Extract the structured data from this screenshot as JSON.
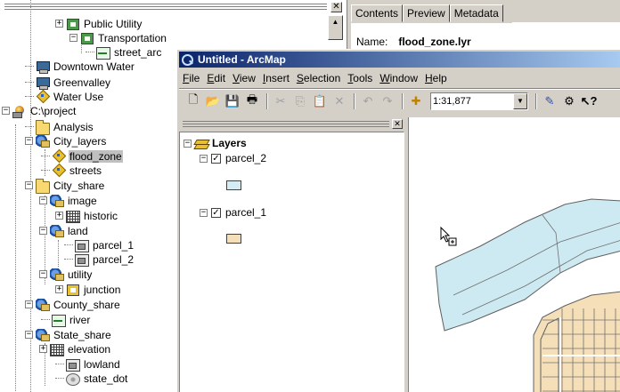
{
  "catalog": {
    "items": [
      {
        "label": "Public Utility",
        "icon": "network-dataset-icon"
      },
      {
        "label": "Transportation",
        "icon": "network-dataset-icon"
      },
      {
        "label": "street_arc",
        "icon": "line-featureclass-icon"
      },
      {
        "label": "Downtown Water",
        "icon": "computer-icon"
      },
      {
        "label": "Greenvalley",
        "icon": "computer-icon"
      },
      {
        "label": "Water Use",
        "icon": "layer-file-icon"
      },
      {
        "label": "C:\\project",
        "icon": "drive-icon"
      },
      {
        "label": "Analysis",
        "icon": "folder-icon"
      },
      {
        "label": "City_layers",
        "icon": "dataset-icon"
      },
      {
        "label": "flood_zone",
        "icon": "layer-file-icon",
        "selected": true
      },
      {
        "label": "streets",
        "icon": "layer-file-icon"
      },
      {
        "label": "City_share",
        "icon": "folder-icon"
      },
      {
        "label": "image",
        "icon": "dataset-icon"
      },
      {
        "label": "historic",
        "icon": "raster-icon"
      },
      {
        "label": "land",
        "icon": "dataset-icon"
      },
      {
        "label": "parcel_1",
        "icon": "polygon-featureclass-icon"
      },
      {
        "label": "parcel_2",
        "icon": "polygon-featureclass-icon"
      },
      {
        "label": "utility",
        "icon": "dataset-icon"
      },
      {
        "label": "junction",
        "icon": "network-dataset-icon"
      },
      {
        "label": "County_share",
        "icon": "dataset-icon"
      },
      {
        "label": "river",
        "icon": "line-featureclass-icon"
      },
      {
        "label": "State_share",
        "icon": "dataset-icon"
      },
      {
        "label": "elevation",
        "icon": "raster-icon"
      },
      {
        "label": "lowland",
        "icon": "polygon-featureclass-icon"
      },
      {
        "label": "state_dot",
        "icon": "point-featureclass-icon"
      }
    ]
  },
  "metadata": {
    "tabs": [
      "Contents",
      "Preview",
      "Metadata"
    ],
    "active_tab": "Contents",
    "name_label": "Name:",
    "name_value": "flood_zone.lyr"
  },
  "arcmap": {
    "title": "Untitled - ArcMap",
    "menus": [
      {
        "label": "File",
        "mnemonic": "F"
      },
      {
        "label": "Edit",
        "mnemonic": "E"
      },
      {
        "label": "View",
        "mnemonic": "V"
      },
      {
        "label": "Insert",
        "mnemonic": "I"
      },
      {
        "label": "Selection",
        "mnemonic": "S"
      },
      {
        "label": "Tools",
        "mnemonic": "T"
      },
      {
        "label": "Window",
        "mnemonic": "W"
      },
      {
        "label": "Help",
        "mnemonic": "H"
      }
    ],
    "scale": "1:31,877",
    "toc": {
      "root": "Layers",
      "layers": [
        {
          "name": "parcel_2",
          "checked": true,
          "fill": "#d6ecf3"
        },
        {
          "name": "parcel_1",
          "checked": true,
          "fill": "#f5dfb8"
        }
      ]
    },
    "colors": {
      "titlebar_start": "#0a246a",
      "titlebar_end": "#a6caf0",
      "flood_fill": "#cde9f2",
      "parcel_fill": "#f5dfb8"
    }
  }
}
